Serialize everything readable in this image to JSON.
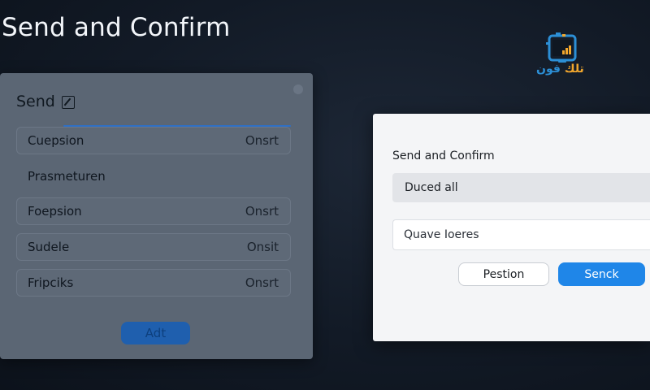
{
  "page": {
    "title": "Send and Confirm"
  },
  "logo": {
    "text_part1": "تلك",
    "text_part2": "فون"
  },
  "left_panel": {
    "title": "Send",
    "rows": [
      {
        "label": "Cuepsion",
        "value": "Onsrt"
      },
      {
        "label": "Prasmeturen",
        "value": ""
      },
      {
        "label": "Foepsion",
        "value": "Onsrt"
      },
      {
        "label": "Sudele",
        "value": "Onsit"
      },
      {
        "label": "Fripciks",
        "value": "Onsrt"
      }
    ],
    "add_label": "Adt"
  },
  "dialog": {
    "title": "Send and Confirm",
    "select_value": "Duced all",
    "input_value": "Quave Ioeres",
    "secondary_label": "Pestion",
    "primary_label": "Senck",
    "colors": {
      "primary": "#1f86e8",
      "surface": "#f4f5f7"
    }
  }
}
